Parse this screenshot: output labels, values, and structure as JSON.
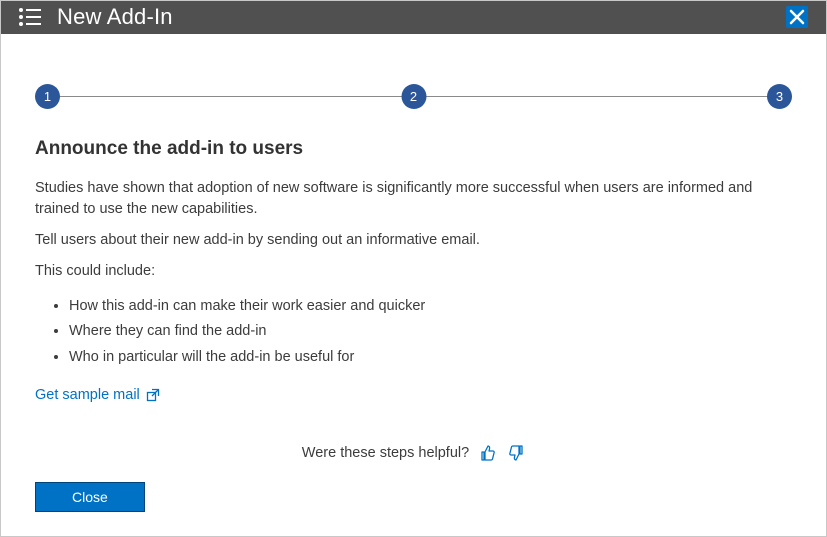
{
  "titlebar": {
    "title": "New Add-In"
  },
  "stepper": {
    "steps": [
      "1",
      "2",
      "3"
    ]
  },
  "page": {
    "heading": "Announce the add-in to users",
    "para1": "Studies have shown that adoption of new software is significantly more successful when users are informed and trained to use the new capabilities.",
    "para2": "Tell users about their new add-in by sending out an informative email.",
    "para3": "This could include:",
    "bullets": [
      "How this add-in can make their work easier and quicker",
      "Where they can find the add-in",
      "Who in particular will the add-in be useful for"
    ],
    "link_label": "Get sample mail",
    "feedback_label": "Were these steps helpful?"
  },
  "buttons": {
    "close_label": "Close"
  },
  "colors": {
    "accent": "#0072c6",
    "step_fill": "#2b579a",
    "titlebar_bg": "#505050"
  }
}
